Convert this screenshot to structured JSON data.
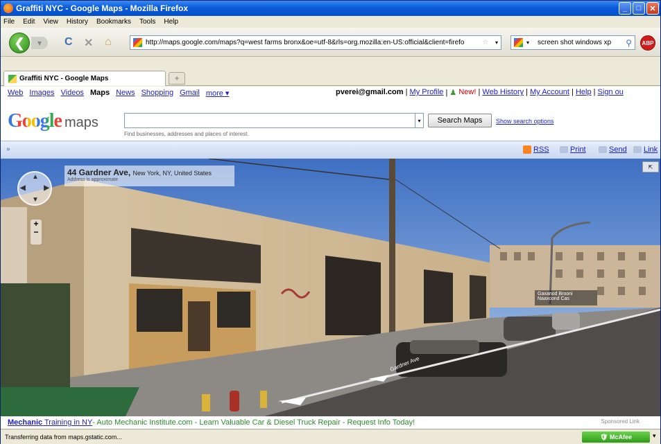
{
  "window": {
    "title": "Graffiti NYC - Google Maps - Mozilla Firefox"
  },
  "menu": [
    "File",
    "Edit",
    "View",
    "History",
    "Bookmarks",
    "Tools",
    "Help"
  ],
  "nav": {
    "url": "http://maps.google.com/maps?q=west farms bronx&oe=utf-8&rls=org.mozilla:en-US:official&client=firefo",
    "search_value": "screen shot windows xp",
    "adblock_label": "ABP"
  },
  "tab": {
    "label": "Graffiti NYC - Google Maps"
  },
  "google_bar": {
    "links": [
      "Web",
      "Images",
      "Videos",
      "Maps",
      "News",
      "Shopping",
      "Gmail",
      "more ▾"
    ],
    "user": "pverei@gmail.com",
    "right_links": [
      "My Profile",
      "New!",
      "Web History",
      "My Account",
      "Help",
      "Sign ou"
    ]
  },
  "maps_header": {
    "logo": "Google",
    "logo_maps": "maps",
    "hint": "Find businesses, addresses and places of interest.",
    "search_button": "Search Maps",
    "show_options": "Show search options"
  },
  "toolrow": {
    "rss": "RSS",
    "print": "Print",
    "send": "Send",
    "link": "Link"
  },
  "streetview": {
    "address_bold": "44 Gardner Ave,",
    "address_rest": "New York, NY, United States",
    "address_note": "Address is approximate",
    "street_label": "Gardner Ave",
    "pin_label": "Gaxanod Brooni Naaxcond Cas"
  },
  "ad": {
    "title": "Mechanic",
    "title_rest": " Training in NY",
    "body": " - Auto Mechanic Institute.com - Learn Valuable Car & Diesel Truck Repair - Request Info Today!",
    "sponsored": "Sponsored Link"
  },
  "status": {
    "text": "Transferring data from maps.gstatic.com...",
    "mcafee": "McAfee"
  }
}
